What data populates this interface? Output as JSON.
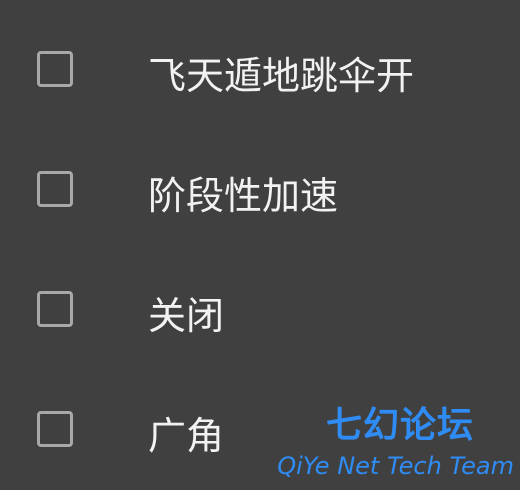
{
  "options": [
    {
      "label": "飞天遁地跳伞开",
      "checked": false
    },
    {
      "label": "阶段性加速",
      "checked": false
    },
    {
      "label": "关闭",
      "checked": false
    },
    {
      "label": "广角",
      "checked": false
    }
  ],
  "watermark": {
    "title": "七幻论坛",
    "subtitle": "QiYe Net Tech Team",
    "color": "#2f8cf5"
  }
}
